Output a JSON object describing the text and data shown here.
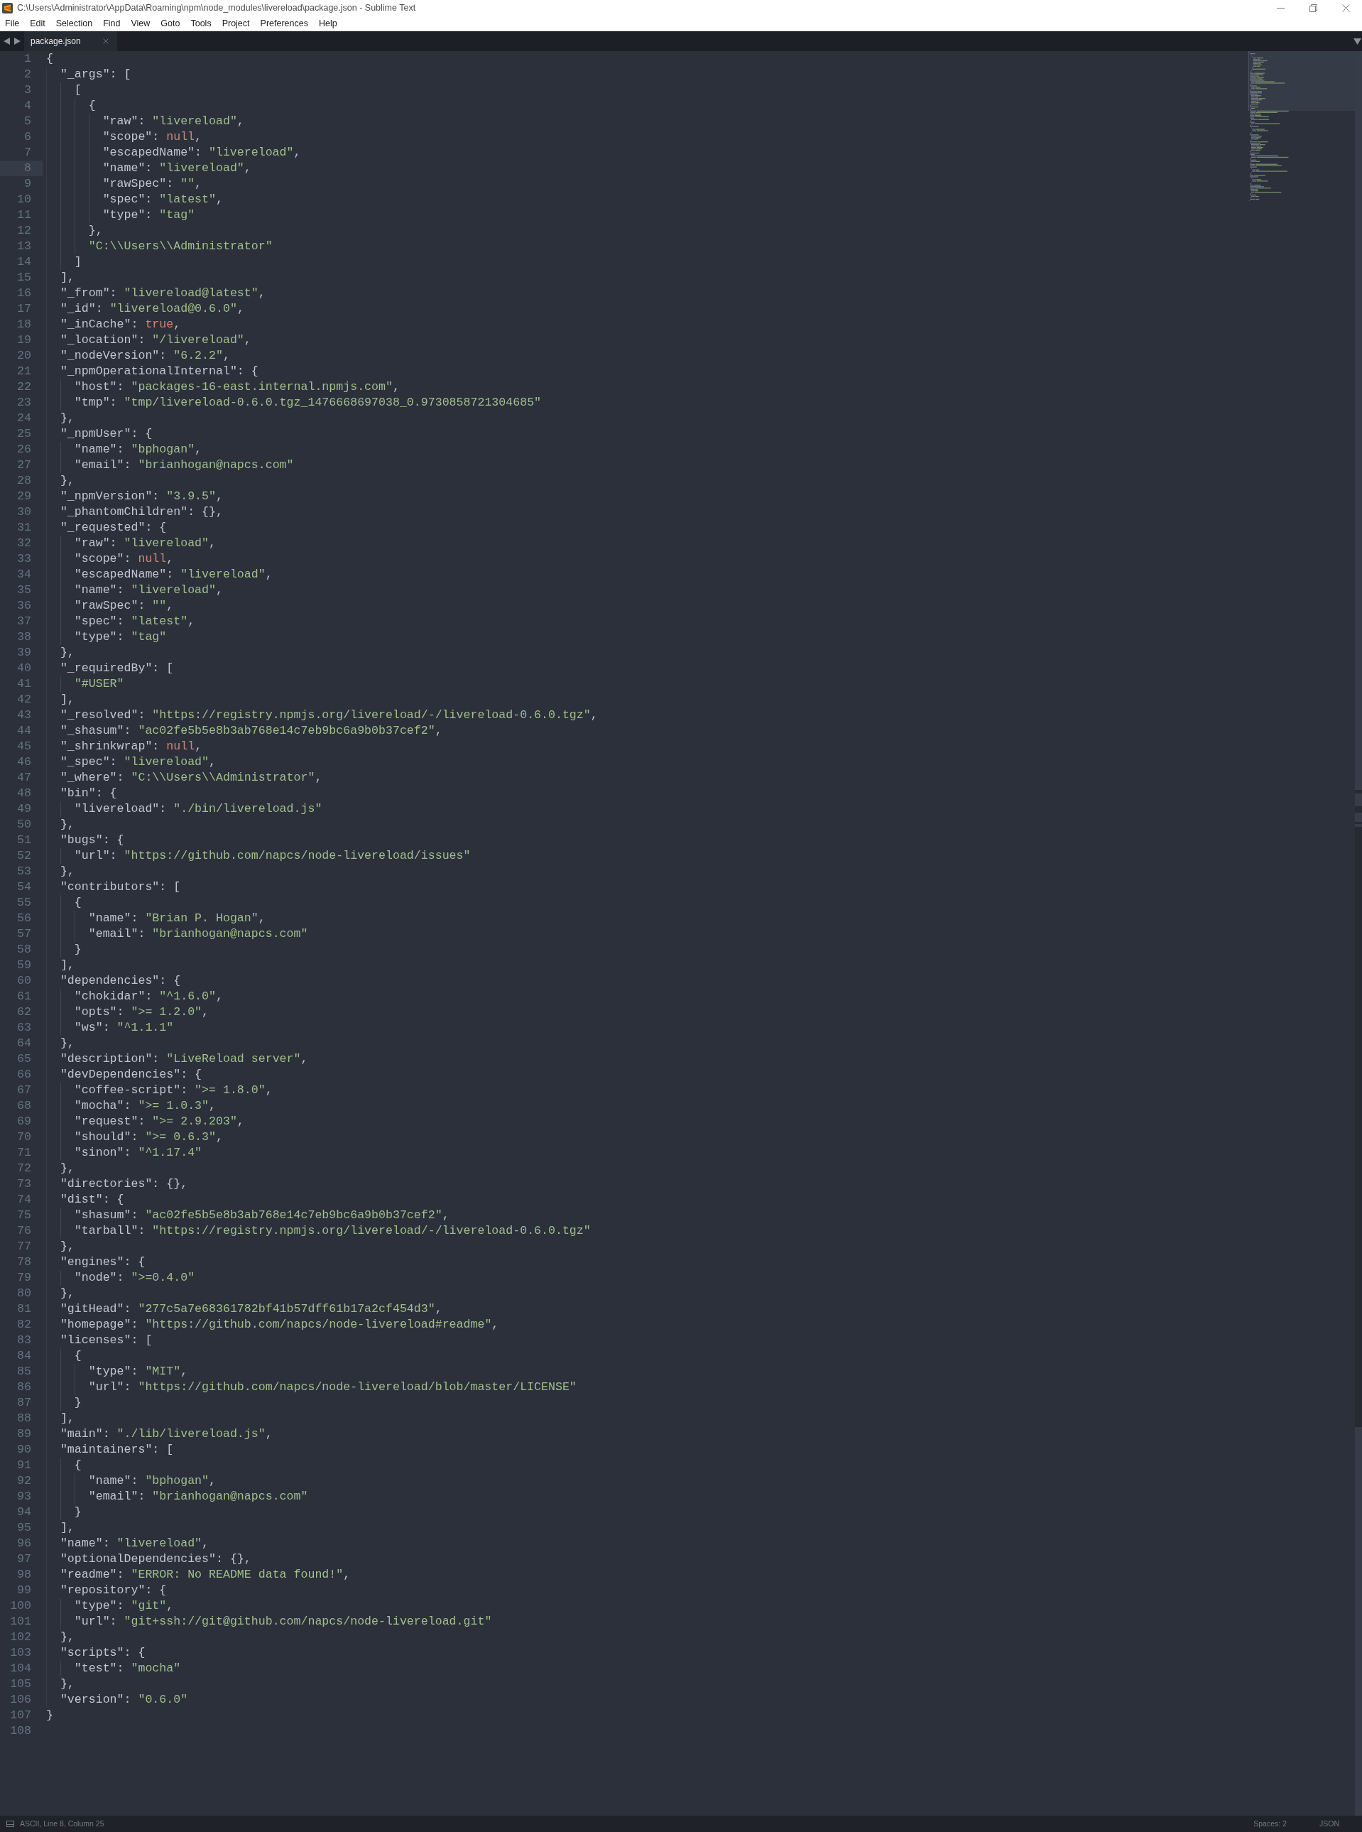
{
  "window": {
    "title": "C:\\Users\\Administrator\\AppData\\Roaming\\npm\\node_modules\\livereload\\package.json - Sublime Text"
  },
  "menu": [
    "File",
    "Edit",
    "Selection",
    "Find",
    "View",
    "Goto",
    "Tools",
    "Project",
    "Preferences",
    "Help"
  ],
  "tabs": [
    {
      "label": "package.json",
      "selected": true
    }
  ],
  "lines": [
    {
      "number": "1",
      "current": false,
      "tokens": [
        {
          "kind": "plain",
          "text": "{"
        }
      ]
    },
    {
      "number": "2",
      "current": false,
      "tokens": [
        {
          "kind": "plain",
          "text": "  \"_args\": ["
        }
      ]
    },
    {
      "number": "3",
      "current": false,
      "tokens": [
        {
          "kind": "plain",
          "text": "    ["
        }
      ]
    },
    {
      "number": "4",
      "current": false,
      "tokens": [
        {
          "kind": "plain",
          "text": "      {"
        }
      ]
    },
    {
      "number": "5",
      "current": false,
      "tokens": [
        {
          "kind": "plain",
          "text": "        \"raw\": "
        },
        {
          "kind": "string",
          "text": "\"livereload\""
        },
        {
          "kind": "plain",
          "text": ","
        }
      ]
    },
    {
      "number": "6",
      "current": false,
      "tokens": [
        {
          "kind": "plain",
          "text": "        \"scope\": "
        },
        {
          "kind": "constant",
          "text": "null"
        },
        {
          "kind": "plain",
          "text": ","
        }
      ]
    },
    {
      "number": "7",
      "current": false,
      "tokens": [
        {
          "kind": "plain",
          "text": "        \"escapedName\": "
        },
        {
          "kind": "string",
          "text": "\"livereload\""
        },
        {
          "kind": "plain",
          "text": ","
        }
      ]
    },
    {
      "number": "8",
      "current": true,
      "tokens": [
        {
          "kind": "plain",
          "text": "        \"name\": "
        },
        {
          "kind": "string",
          "text": "\"livereload\""
        },
        {
          "kind": "plain",
          "text": ","
        }
      ]
    },
    {
      "number": "9",
      "current": false,
      "tokens": [
        {
          "kind": "plain",
          "text": "        \"rawSpec\": "
        },
        {
          "kind": "string",
          "text": "\"\""
        },
        {
          "kind": "plain",
          "text": ","
        }
      ]
    },
    {
      "number": "10",
      "current": false,
      "tokens": [
        {
          "kind": "plain",
          "text": "        \"spec\": "
        },
        {
          "kind": "string",
          "text": "\"latest\""
        },
        {
          "kind": "plain",
          "text": ","
        }
      ]
    },
    {
      "number": "11",
      "current": false,
      "tokens": [
        {
          "kind": "plain",
          "text": "        \"type\": "
        },
        {
          "kind": "string",
          "text": "\"tag\""
        }
      ]
    },
    {
      "number": "12",
      "current": false,
      "tokens": [
        {
          "kind": "plain",
          "text": "      },"
        }
      ]
    },
    {
      "number": "13",
      "current": false,
      "tokens": [
        {
          "kind": "string",
          "text": "      \"C:\\\\Users\\\\Administrator\""
        }
      ]
    },
    {
      "number": "14",
      "current": false,
      "tokens": [
        {
          "kind": "plain",
          "text": "    ]"
        }
      ]
    },
    {
      "number": "15",
      "current": false,
      "tokens": [
        {
          "kind": "plain",
          "text": "  ],"
        }
      ]
    },
    {
      "number": "16",
      "current": false,
      "tokens": [
        {
          "kind": "plain",
          "text": "  \"_from\": "
        },
        {
          "kind": "string",
          "text": "\"livereload@latest\""
        },
        {
          "kind": "plain",
          "text": ","
        }
      ]
    },
    {
      "number": "17",
      "current": false,
      "tokens": [
        {
          "kind": "plain",
          "text": "  \"_id\": "
        },
        {
          "kind": "string",
          "text": "\"livereload@0.6.0\""
        },
        {
          "kind": "plain",
          "text": ","
        }
      ]
    },
    {
      "number": "18",
      "current": false,
      "tokens": [
        {
          "kind": "plain",
          "text": "  \"_inCache\": "
        },
        {
          "kind": "constant",
          "text": "true"
        },
        {
          "kind": "plain",
          "text": ","
        }
      ]
    },
    {
      "number": "19",
      "current": false,
      "tokens": [
        {
          "kind": "plain",
          "text": "  \"_location\": "
        },
        {
          "kind": "string",
          "text": "\"/livereload\""
        },
        {
          "kind": "plain",
          "text": ","
        }
      ]
    },
    {
      "number": "20",
      "current": false,
      "tokens": [
        {
          "kind": "plain",
          "text": "  \"_nodeVersion\": "
        },
        {
          "kind": "string",
          "text": "\"6.2.2\""
        },
        {
          "kind": "plain",
          "text": ","
        }
      ]
    },
    {
      "number": "21",
      "current": false,
      "tokens": [
        {
          "kind": "plain",
          "text": "  \"_npmOperationalInternal\": {"
        }
      ]
    },
    {
      "number": "22",
      "current": false,
      "tokens": [
        {
          "kind": "plain",
          "text": "    \"host\": "
        },
        {
          "kind": "string",
          "text": "\"packages-16-east.internal.npmjs.com\""
        },
        {
          "kind": "plain",
          "text": ","
        }
      ]
    },
    {
      "number": "23",
      "current": false,
      "tokens": [
        {
          "kind": "plain",
          "text": "    \"tmp\": "
        },
        {
          "kind": "string",
          "text": "\"tmp/livereload-0.6.0.tgz_1476668697038_0.9730858721304685\""
        }
      ]
    },
    {
      "number": "24",
      "current": false,
      "tokens": [
        {
          "kind": "plain",
          "text": "  },"
        }
      ]
    },
    {
      "number": "25",
      "current": false,
      "tokens": [
        {
          "kind": "plain",
          "text": "  \"_npmUser\": {"
        }
      ]
    },
    {
      "number": "26",
      "current": false,
      "tokens": [
        {
          "kind": "plain",
          "text": "    \"name\": "
        },
        {
          "kind": "string",
          "text": "\"bphogan\""
        },
        {
          "kind": "plain",
          "text": ","
        }
      ]
    },
    {
      "number": "27",
      "current": false,
      "tokens": [
        {
          "kind": "plain",
          "text": "    \"email\": "
        },
        {
          "kind": "string",
          "text": "\"brianhogan@napcs.com\""
        }
      ]
    },
    {
      "number": "28",
      "current": false,
      "tokens": [
        {
          "kind": "plain",
          "text": "  },"
        }
      ]
    },
    {
      "number": "29",
      "current": false,
      "tokens": [
        {
          "kind": "plain",
          "text": "  \"_npmVersion\": "
        },
        {
          "kind": "string",
          "text": "\"3.9.5\""
        },
        {
          "kind": "plain",
          "text": ","
        }
      ]
    },
    {
      "number": "30",
      "current": false,
      "tokens": [
        {
          "kind": "plain",
          "text": "  \"_phantomChildren\": {},"
        }
      ]
    },
    {
      "number": "31",
      "current": false,
      "tokens": [
        {
          "kind": "plain",
          "text": "  \"_requested\": {"
        }
      ]
    },
    {
      "number": "32",
      "current": false,
      "tokens": [
        {
          "kind": "plain",
          "text": "    \"raw\": "
        },
        {
          "kind": "string",
          "text": "\"livereload\""
        },
        {
          "kind": "plain",
          "text": ","
        }
      ]
    },
    {
      "number": "33",
      "current": false,
      "tokens": [
        {
          "kind": "plain",
          "text": "    \"scope\": "
        },
        {
          "kind": "constant",
          "text": "null"
        },
        {
          "kind": "plain",
          "text": ","
        }
      ]
    },
    {
      "number": "34",
      "current": false,
      "tokens": [
        {
          "kind": "plain",
          "text": "    \"escapedName\": "
        },
        {
          "kind": "string",
          "text": "\"livereload\""
        },
        {
          "kind": "plain",
          "text": ","
        }
      ]
    },
    {
      "number": "35",
      "current": false,
      "tokens": [
        {
          "kind": "plain",
          "text": "    \"name\": "
        },
        {
          "kind": "string",
          "text": "\"livereload\""
        },
        {
          "kind": "plain",
          "text": ","
        }
      ]
    },
    {
      "number": "36",
      "current": false,
      "tokens": [
        {
          "kind": "plain",
          "text": "    \"rawSpec\": "
        },
        {
          "kind": "string",
          "text": "\"\""
        },
        {
          "kind": "plain",
          "text": ","
        }
      ]
    },
    {
      "number": "37",
      "current": false,
      "tokens": [
        {
          "kind": "plain",
          "text": "    \"spec\": "
        },
        {
          "kind": "string",
          "text": "\"latest\""
        },
        {
          "kind": "plain",
          "text": ","
        }
      ]
    },
    {
      "number": "38",
      "current": false,
      "tokens": [
        {
          "kind": "plain",
          "text": "    \"type\": "
        },
        {
          "kind": "string",
          "text": "\"tag\""
        }
      ]
    },
    {
      "number": "39",
      "current": false,
      "tokens": [
        {
          "kind": "plain",
          "text": "  },"
        }
      ]
    },
    {
      "number": "40",
      "current": false,
      "tokens": [
        {
          "kind": "plain",
          "text": "  \"_requiredBy\": ["
        }
      ]
    },
    {
      "number": "41",
      "current": false,
      "tokens": [
        {
          "kind": "string",
          "text": "    \"#USER\""
        }
      ]
    },
    {
      "number": "42",
      "current": false,
      "tokens": [
        {
          "kind": "plain",
          "text": "  ],"
        }
      ]
    },
    {
      "number": "43",
      "current": false,
      "tokens": [
        {
          "kind": "plain",
          "text": "  \"_resolved\": "
        },
        {
          "kind": "string",
          "text": "\"https://registry.npmjs.org/livereload/-/livereload-0.6.0.tgz\""
        },
        {
          "kind": "plain",
          "text": ","
        }
      ]
    },
    {
      "number": "44",
      "current": false,
      "tokens": [
        {
          "kind": "plain",
          "text": "  \"_shasum\": "
        },
        {
          "kind": "string",
          "text": "\"ac02fe5b5e8b3ab768e14c7eb9bc6a9b0b37cef2\""
        },
        {
          "kind": "plain",
          "text": ","
        }
      ]
    },
    {
      "number": "45",
      "current": false,
      "tokens": [
        {
          "kind": "plain",
          "text": "  \"_shrinkwrap\": "
        },
        {
          "kind": "constant",
          "text": "null"
        },
        {
          "kind": "plain",
          "text": ","
        }
      ]
    },
    {
      "number": "46",
      "current": false,
      "tokens": [
        {
          "kind": "plain",
          "text": "  \"_spec\": "
        },
        {
          "kind": "string",
          "text": "\"livereload\""
        },
        {
          "kind": "plain",
          "text": ","
        }
      ]
    },
    {
      "number": "47",
      "current": false,
      "tokens": [
        {
          "kind": "plain",
          "text": "  \"_where\": "
        },
        {
          "kind": "string",
          "text": "\"C:\\\\Users\\\\Administrator\""
        },
        {
          "kind": "plain",
          "text": ","
        }
      ]
    },
    {
      "number": "48",
      "current": false,
      "tokens": [
        {
          "kind": "plain",
          "text": "  \"bin\": {"
        }
      ]
    },
    {
      "number": "49",
      "current": false,
      "tokens": [
        {
          "kind": "plain",
          "text": "    \"livereload\": "
        },
        {
          "kind": "string",
          "text": "\"./bin/livereload.js\""
        }
      ]
    },
    {
      "number": "50",
      "current": false,
      "tokens": [
        {
          "kind": "plain",
          "text": "  },"
        }
      ]
    },
    {
      "number": "51",
      "current": false,
      "tokens": [
        {
          "kind": "plain",
          "text": "  \"bugs\": {"
        }
      ]
    },
    {
      "number": "52",
      "current": false,
      "tokens": [
        {
          "kind": "plain",
          "text": "    \"url\": "
        },
        {
          "kind": "string",
          "text": "\"https://github.com/napcs/node-livereload/issues\""
        }
      ]
    },
    {
      "number": "53",
      "current": false,
      "tokens": [
        {
          "kind": "plain",
          "text": "  },"
        }
      ]
    },
    {
      "number": "54",
      "current": false,
      "tokens": [
        {
          "kind": "plain",
          "text": "  \"contributors\": ["
        }
      ]
    },
    {
      "number": "55",
      "current": false,
      "tokens": [
        {
          "kind": "plain",
          "text": "    {"
        }
      ]
    },
    {
      "number": "56",
      "current": false,
      "tokens": [
        {
          "kind": "plain",
          "text": "      \"name\": "
        },
        {
          "kind": "string",
          "text": "\"Brian P. Hogan\""
        },
        {
          "kind": "plain",
          "text": ","
        }
      ]
    },
    {
      "number": "57",
      "current": false,
      "tokens": [
        {
          "kind": "plain",
          "text": "      \"email\": "
        },
        {
          "kind": "string",
          "text": "\"brianhogan@napcs.com\""
        }
      ]
    },
    {
      "number": "58",
      "current": false,
      "tokens": [
        {
          "kind": "plain",
          "text": "    }"
        }
      ]
    },
    {
      "number": "59",
      "current": false,
      "tokens": [
        {
          "kind": "plain",
          "text": "  ],"
        }
      ]
    },
    {
      "number": "60",
      "current": false,
      "tokens": [
        {
          "kind": "plain",
          "text": "  \"dependencies\": {"
        }
      ]
    },
    {
      "number": "61",
      "current": false,
      "tokens": [
        {
          "kind": "plain",
          "text": "    \"chokidar\": "
        },
        {
          "kind": "string",
          "text": "\"^1.6.0\""
        },
        {
          "kind": "plain",
          "text": ","
        }
      ]
    },
    {
      "number": "62",
      "current": false,
      "tokens": [
        {
          "kind": "plain",
          "text": "    \"opts\": "
        },
        {
          "kind": "string",
          "text": "\">= 1.2.0\""
        },
        {
          "kind": "plain",
          "text": ","
        }
      ]
    },
    {
      "number": "63",
      "current": false,
      "tokens": [
        {
          "kind": "plain",
          "text": "    \"ws\": "
        },
        {
          "kind": "string",
          "text": "\"^1.1.1\""
        }
      ]
    },
    {
      "number": "64",
      "current": false,
      "tokens": [
        {
          "kind": "plain",
          "text": "  },"
        }
      ]
    },
    {
      "number": "65",
      "current": false,
      "tokens": [
        {
          "kind": "plain",
          "text": "  \"description\": "
        },
        {
          "kind": "string",
          "text": "\"LiveReload server\""
        },
        {
          "kind": "plain",
          "text": ","
        }
      ]
    },
    {
      "number": "66",
      "current": false,
      "tokens": [
        {
          "kind": "plain",
          "text": "  \"devDependencies\": {"
        }
      ]
    },
    {
      "number": "67",
      "current": false,
      "tokens": [
        {
          "kind": "plain",
          "text": "    \"coffee-script\": "
        },
        {
          "kind": "string",
          "text": "\">= 1.8.0\""
        },
        {
          "kind": "plain",
          "text": ","
        }
      ]
    },
    {
      "number": "68",
      "current": false,
      "tokens": [
        {
          "kind": "plain",
          "text": "    \"mocha\": "
        },
        {
          "kind": "string",
          "text": "\">= 1.0.3\""
        },
        {
          "kind": "plain",
          "text": ","
        }
      ]
    },
    {
      "number": "69",
      "current": false,
      "tokens": [
        {
          "kind": "plain",
          "text": "    \"request\": "
        },
        {
          "kind": "string",
          "text": "\">= 2.9.203\""
        },
        {
          "kind": "plain",
          "text": ","
        }
      ]
    },
    {
      "number": "70",
      "current": false,
      "tokens": [
        {
          "kind": "plain",
          "text": "    \"should\": "
        },
        {
          "kind": "string",
          "text": "\">= 0.6.3\""
        },
        {
          "kind": "plain",
          "text": ","
        }
      ]
    },
    {
      "number": "71",
      "current": false,
      "tokens": [
        {
          "kind": "plain",
          "text": "    \"sinon\": "
        },
        {
          "kind": "string",
          "text": "\"^1.17.4\""
        }
      ]
    },
    {
      "number": "72",
      "current": false,
      "tokens": [
        {
          "kind": "plain",
          "text": "  },"
        }
      ]
    },
    {
      "number": "73",
      "current": false,
      "tokens": [
        {
          "kind": "plain",
          "text": "  \"directories\": {},"
        }
      ]
    },
    {
      "number": "74",
      "current": false,
      "tokens": [
        {
          "kind": "plain",
          "text": "  \"dist\": {"
        }
      ]
    },
    {
      "number": "75",
      "current": false,
      "tokens": [
        {
          "kind": "plain",
          "text": "    \"shasum\": "
        },
        {
          "kind": "string",
          "text": "\"ac02fe5b5e8b3ab768e14c7eb9bc6a9b0b37cef2\""
        },
        {
          "kind": "plain",
          "text": ","
        }
      ]
    },
    {
      "number": "76",
      "current": false,
      "tokens": [
        {
          "kind": "plain",
          "text": "    \"tarball\": "
        },
        {
          "kind": "string",
          "text": "\"https://registry.npmjs.org/livereload/-/livereload-0.6.0.tgz\""
        }
      ]
    },
    {
      "number": "77",
      "current": false,
      "tokens": [
        {
          "kind": "plain",
          "text": "  },"
        }
      ]
    },
    {
      "number": "78",
      "current": false,
      "tokens": [
        {
          "kind": "plain",
          "text": "  \"engines\": {"
        }
      ]
    },
    {
      "number": "79",
      "current": false,
      "tokens": [
        {
          "kind": "plain",
          "text": "    \"node\": "
        },
        {
          "kind": "string",
          "text": "\">=0.4.0\""
        }
      ]
    },
    {
      "number": "80",
      "current": false,
      "tokens": [
        {
          "kind": "plain",
          "text": "  },"
        }
      ]
    },
    {
      "number": "81",
      "current": false,
      "tokens": [
        {
          "kind": "plain",
          "text": "  \"gitHead\": "
        },
        {
          "kind": "string",
          "text": "\"277c5a7e68361782bf41b57dff61b17a2cf454d3\""
        },
        {
          "kind": "plain",
          "text": ","
        }
      ]
    },
    {
      "number": "82",
      "current": false,
      "tokens": [
        {
          "kind": "plain",
          "text": "  \"homepage\": "
        },
        {
          "kind": "string",
          "text": "\"https://github.com/napcs/node-livereload#readme\""
        },
        {
          "kind": "plain",
          "text": ","
        }
      ]
    },
    {
      "number": "83",
      "current": false,
      "tokens": [
        {
          "kind": "plain",
          "text": "  \"licenses\": ["
        }
      ]
    },
    {
      "number": "84",
      "current": false,
      "tokens": [
        {
          "kind": "plain",
          "text": "    {"
        }
      ]
    },
    {
      "number": "85",
      "current": false,
      "tokens": [
        {
          "kind": "plain",
          "text": "      \"type\": "
        },
        {
          "kind": "string",
          "text": "\"MIT\""
        },
        {
          "kind": "plain",
          "text": ","
        }
      ]
    },
    {
      "number": "86",
      "current": false,
      "tokens": [
        {
          "kind": "plain",
          "text": "      \"url\": "
        },
        {
          "kind": "string",
          "text": "\"https://github.com/napcs/node-livereload/blob/master/LICENSE\""
        }
      ]
    },
    {
      "number": "87",
      "current": false,
      "tokens": [
        {
          "kind": "plain",
          "text": "    }"
        }
      ]
    },
    {
      "number": "88",
      "current": false,
      "tokens": [
        {
          "kind": "plain",
          "text": "  ],"
        }
      ]
    },
    {
      "number": "89",
      "current": false,
      "tokens": [
        {
          "kind": "plain",
          "text": "  \"main\": "
        },
        {
          "kind": "string",
          "text": "\"./lib/livereload.js\""
        },
        {
          "kind": "plain",
          "text": ","
        }
      ]
    },
    {
      "number": "90",
      "current": false,
      "tokens": [
        {
          "kind": "plain",
          "text": "  \"maintainers\": ["
        }
      ]
    },
    {
      "number": "91",
      "current": false,
      "tokens": [
        {
          "kind": "plain",
          "text": "    {"
        }
      ]
    },
    {
      "number": "92",
      "current": false,
      "tokens": [
        {
          "kind": "plain",
          "text": "      \"name\": "
        },
        {
          "kind": "string",
          "text": "\"bphogan\""
        },
        {
          "kind": "plain",
          "text": ","
        }
      ]
    },
    {
      "number": "93",
      "current": false,
      "tokens": [
        {
          "kind": "plain",
          "text": "      \"email\": "
        },
        {
          "kind": "string",
          "text": "\"brianhogan@napcs.com\""
        }
      ]
    },
    {
      "number": "94",
      "current": false,
      "tokens": [
        {
          "kind": "plain",
          "text": "    }"
        }
      ]
    },
    {
      "number": "95",
      "current": false,
      "tokens": [
        {
          "kind": "plain",
          "text": "  ],"
        }
      ]
    },
    {
      "number": "96",
      "current": false,
      "tokens": [
        {
          "kind": "plain",
          "text": "  \"name\": "
        },
        {
          "kind": "string",
          "text": "\"livereload\""
        },
        {
          "kind": "plain",
          "text": ","
        }
      ]
    },
    {
      "number": "97",
      "current": false,
      "tokens": [
        {
          "kind": "plain",
          "text": "  \"optionalDependencies\": {},"
        }
      ]
    },
    {
      "number": "98",
      "current": false,
      "tokens": [
        {
          "kind": "plain",
          "text": "  \"readme\": "
        },
        {
          "kind": "string",
          "text": "\"ERROR: No README data found!\""
        },
        {
          "kind": "plain",
          "text": ","
        }
      ]
    },
    {
      "number": "99",
      "current": false,
      "tokens": [
        {
          "kind": "plain",
          "text": "  \"repository\": {"
        }
      ]
    },
    {
      "number": "100",
      "current": false,
      "tokens": [
        {
          "kind": "plain",
          "text": "    \"type\": "
        },
        {
          "kind": "string",
          "text": "\"git\""
        },
        {
          "kind": "plain",
          "text": ","
        }
      ]
    },
    {
      "number": "101",
      "current": false,
      "tokens": [
        {
          "kind": "plain",
          "text": "    \"url\": "
        },
        {
          "kind": "string",
          "text": "\"git+ssh://git@github.com/napcs/node-livereload.git\""
        }
      ]
    },
    {
      "number": "102",
      "current": false,
      "tokens": [
        {
          "kind": "plain",
          "text": "  },"
        }
      ]
    },
    {
      "number": "103",
      "current": false,
      "tokens": [
        {
          "kind": "plain",
          "text": "  \"scripts\": {"
        }
      ]
    },
    {
      "number": "104",
      "current": false,
      "tokens": [
        {
          "kind": "plain",
          "text": "    \"test\": "
        },
        {
          "kind": "string",
          "text": "\"mocha\""
        }
      ]
    },
    {
      "number": "105",
      "current": false,
      "tokens": [
        {
          "kind": "plain",
          "text": "  },"
        }
      ]
    },
    {
      "number": "106",
      "current": false,
      "tokens": [
        {
          "kind": "plain",
          "text": "  \"version\": "
        },
        {
          "kind": "string",
          "text": "\"0.6.0\""
        }
      ]
    },
    {
      "number": "107",
      "current": false,
      "tokens": [
        {
          "kind": "plain",
          "text": "}"
        }
      ]
    },
    {
      "number": "108",
      "current": false
    }
  ],
  "status_bar": {
    "position": "ASCII, Line 8, Column 25",
    "indentation": "Spaces: 2",
    "syntax": "JSON"
  }
}
